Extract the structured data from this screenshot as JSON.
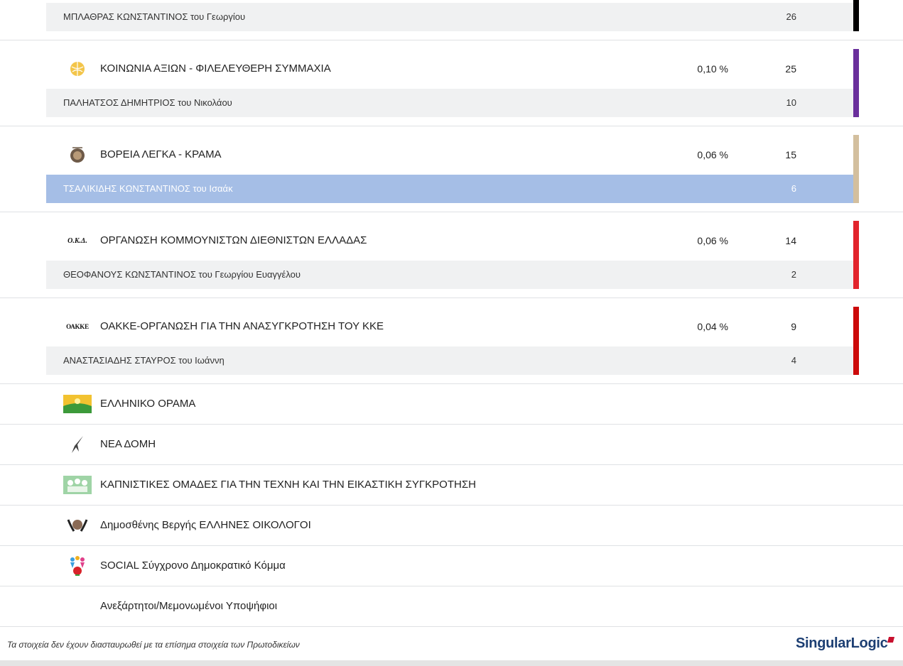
{
  "rows_top": {
    "candidate_0": {
      "name": "ΜΠΛΑΘΡΑΣ ΚΩΝΣΤΑΝΤΙΝΟΣ του Γεωργίου",
      "votes": "26",
      "bar_color": "#000000"
    }
  },
  "parties": [
    {
      "name": "ΚΟΙΝΩΝΙΑ ΑΞΙΩΝ - ΦΙΛΕΛΕΥΘΕΡΗ ΣΥΜΜΑΧΙΑ",
      "percent": "0,10 %",
      "seats": "25",
      "logo_icon": "orange-ball-logo-icon",
      "color": "#6a2f9c",
      "candidate": {
        "name": "ΠΑΛΗΑΤΣΟΣ ΔΗΜΗΤΡΙΟΣ του Νικολάου",
        "votes": "10"
      }
    },
    {
      "name": "ΒΟΡΕΙΑ ΛΕΓΚΑ - ΚΡΑΜΑ",
      "percent": "0,06 %",
      "seats": "15",
      "logo_icon": "emblem-seal-logo-icon",
      "color": "#d3bf9e",
      "candidate": {
        "name": "ΤΣΑΛΙΚΙΔΗΣ ΚΩΝΣΤΑΝΤΙΝΟΣ του Ισαάκ",
        "votes": "6",
        "selected": true
      }
    },
    {
      "name": "ΟΡΓΑΝΩΣΗ ΚΟΜΜΟΥΝΙΣΤΩΝ ΔΙΕΘΝΙΣΤΩΝ ΕΛΛΑΔΑΣ",
      "percent": "0,06 %",
      "seats": "14",
      "logo_text": "Ο.Κ.Δ.",
      "color": "#e2242c",
      "candidate": {
        "name": "ΘΕΟΦΑΝΟΥΣ ΚΩΝΣΤΑΝΤΙΝΟΣ του Γεωργίου Ευαγγέλου",
        "votes": "2"
      }
    },
    {
      "name": "ΟΑΚΚΕ-ΟΡΓΑΝΩΣΗ ΓΙΑ ΤΗΝ ΑΝΑΣΥΓΚΡΟΤΗΣΗ ΤΟΥ ΚΚΕ",
      "percent": "0,04 %",
      "seats": "9",
      "logo_text": "ΟΑΚΚΕ",
      "color": "#cc0a0a",
      "candidate": {
        "name": "ΑΝΑΣΤΑΣΙΑΔΗΣ ΣΤΑΥΡΟΣ του Ιωάννη",
        "votes": "4"
      }
    }
  ],
  "simple_parties": [
    {
      "name": "ΕΛΛΗΝΙΚΟ ΟΡΑΜΑ",
      "logo_icon": "green-landscape-logo-icon"
    },
    {
      "name": "ΝΕΑ ΔΟΜΗ",
      "logo_icon": "swallow-bird-logo-icon"
    },
    {
      "name": "ΚΑΠΝΙΣΤΙΚΕΣ ΟΜΑΔΕΣ ΓΙΑ ΤΗΝ ΤΕΧΝΗ ΚΑΙ ΤΗΝ ΕΙΚΑΣΤΙΚΗ ΣΥΓΚΡΟΤΗΣΗ",
      "logo_icon": "people-group-logo-icon"
    },
    {
      "name": "Δημοσθένης Βεργής ΕΛΛΗΝΕΣ ΟΙΚΟΛΟΓΟΙ",
      "logo_icon": "hands-circle-logo-icon"
    },
    {
      "name": "SOCIAL Σύγχρονο Δημοκρατικό Κόμμα",
      "logo_icon": "colorful-figures-logo-icon"
    },
    {
      "name": "Ανεξάρτητοι/Μεμονωμένοι Υποψήφιοι",
      "logo_icon": ""
    }
  ],
  "footer": {
    "note": "Τα στοιχεία δεν έχουν διασταυρωθεί με τα επίσημα στοιχεία των Πρωτοδικείων",
    "brand_part1": "Singular",
    "brand_part2": "Logic"
  }
}
